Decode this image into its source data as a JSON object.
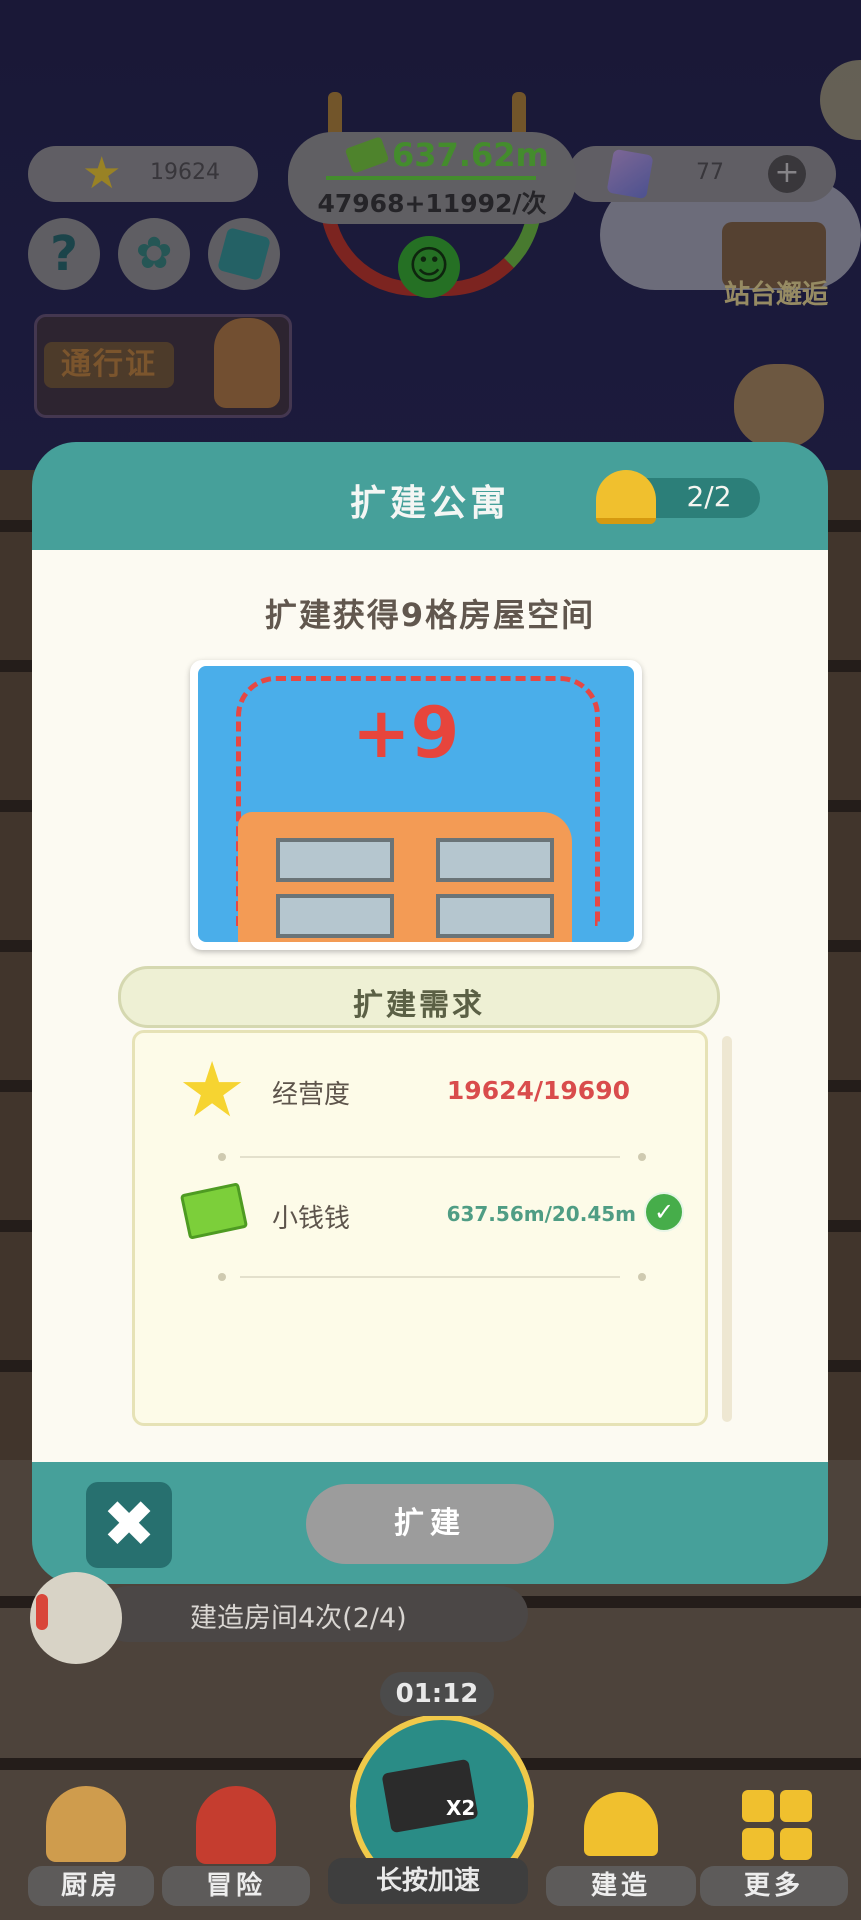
{
  "hud": {
    "stars": "19624",
    "money": "637.62m",
    "income": "47968+11992/次",
    "gems": "77",
    "gem_add_symbol": "+",
    "help_symbol": "?",
    "pass_label": "通行证",
    "station_label": "站台邂逅"
  },
  "modal": {
    "title": "扩建公寓",
    "worker_count": "2/2",
    "subtitle": "扩建获得9格房屋空间",
    "preview_bonus": "+9",
    "requirements_title": "扩建需求",
    "requirements": [
      {
        "name": "经营度",
        "value": "19624/19690",
        "met": false,
        "icon": "star-icon",
        "value_color": "#d94c4c"
      },
      {
        "name": "小钱钱",
        "value": "637.56m/20.45m",
        "met": true,
        "icon": "cash-icon",
        "value_color": "#4f9d84"
      }
    ],
    "close_symbol": "✖",
    "expand_label": "扩建"
  },
  "task": {
    "text": "建造房间4次(2/4)"
  },
  "speedup": {
    "timer": "01:12",
    "multiplier": "X2",
    "label": "长按加速"
  },
  "nav": {
    "kitchen": "厨房",
    "adventure": "冒险",
    "build": "建造",
    "more": "更多"
  },
  "colors": {
    "modal_teal": "#46a09a",
    "money_green": "#6ee24a",
    "unmet_red": "#d94c4c"
  }
}
